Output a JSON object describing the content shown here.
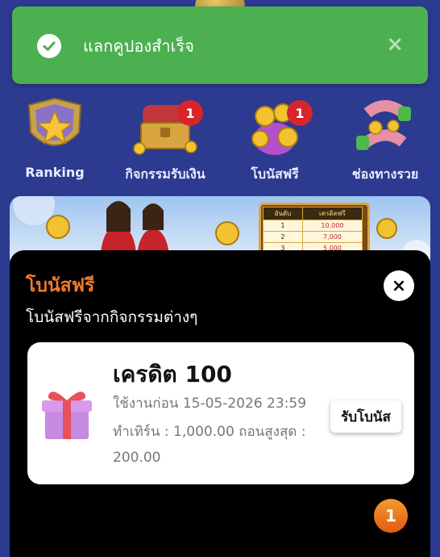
{
  "toast": {
    "message": "แลกคูปองสำเร็จ",
    "icon": "check-circle-icon",
    "close": "×"
  },
  "menu": [
    {
      "label": "Ranking",
      "icon": "ranking-trophy-icon",
      "badge": null
    },
    {
      "label": "กิจกรรมรับเงิน",
      "icon": "treasure-chest-icon",
      "badge": "1"
    },
    {
      "label": "โบนัสฟรี",
      "icon": "coin-bag-icon",
      "badge": "1"
    },
    {
      "label": "ช่องทางรวย",
      "icon": "magnet-icon",
      "badge": null
    }
  ],
  "banner": {
    "board_headers": [
      "อันดับ",
      "เครดิตฟรี"
    ],
    "board_rows": [
      [
        "1",
        "10,000"
      ],
      [
        "2",
        "7,000"
      ],
      [
        "3",
        "5,000"
      ]
    ]
  },
  "sheet": {
    "title": "โบนัสฟรี",
    "subtitle": "โบนัสฟรีจากกิจกรรมต่างๆ",
    "close": "×",
    "card": {
      "credit": "เครดิต 100",
      "line1": "ใช้งานก่อน  15-05-2026  23:59",
      "line2": "ทำเทิร์น : 1,000.00  ถอนสูงสุด :",
      "line3": "200.00",
      "claim_label": "รับโบนัส"
    },
    "page_badge": "1"
  },
  "colors": {
    "background": "#2c3a8f",
    "toast": "#4caf50",
    "title_accent": "#f07a2a",
    "badge": "#d6262b"
  }
}
